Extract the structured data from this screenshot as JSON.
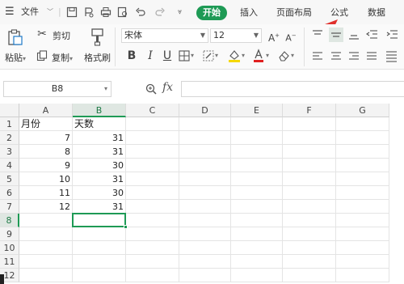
{
  "menu": {
    "file_label": "文件",
    "tabs": [
      {
        "label": "开始",
        "active": true
      },
      {
        "label": "插入",
        "active": false
      },
      {
        "label": "页面布局",
        "active": false
      },
      {
        "label": "公式",
        "active": false
      },
      {
        "label": "数据",
        "active": false
      }
    ]
  },
  "ribbon": {
    "cut_label": "剪切",
    "paste_label": "粘贴",
    "copy_label": "复制",
    "format_painter_label": "格式刷",
    "font_name": "宋体",
    "font_size": "12"
  },
  "formula_bar": {
    "name_box": "B8",
    "fx_label": "fx",
    "formula": ""
  },
  "sheet": {
    "columns": [
      "A",
      "B",
      "C",
      "D",
      "E",
      "F",
      "G"
    ],
    "selected_column": "B",
    "rows": [
      {
        "num": "1",
        "A": "月份",
        "B": "天数"
      },
      {
        "num": "2",
        "A": "7",
        "B": "31"
      },
      {
        "num": "3",
        "A": "8",
        "B": "31"
      },
      {
        "num": "4",
        "A": "9",
        "B": "30"
      },
      {
        "num": "5",
        "A": "10",
        "B": "31"
      },
      {
        "num": "6",
        "A": "11",
        "B": "30"
      },
      {
        "num": "7",
        "A": "12",
        "B": "31"
      },
      {
        "num": "8",
        "A": "",
        "B": ""
      },
      {
        "num": "9",
        "A": "",
        "B": ""
      },
      {
        "num": "10",
        "A": "",
        "B": ""
      },
      {
        "num": "11",
        "A": "",
        "B": ""
      },
      {
        "num": "12",
        "A": "",
        "B": ""
      }
    ],
    "selected_cell": "B8"
  },
  "colors": {
    "accent": "#1e9a55",
    "arrow": "#e0302c",
    "font_color_bar": "#e02020",
    "highlight_bar": "#f5d800"
  }
}
